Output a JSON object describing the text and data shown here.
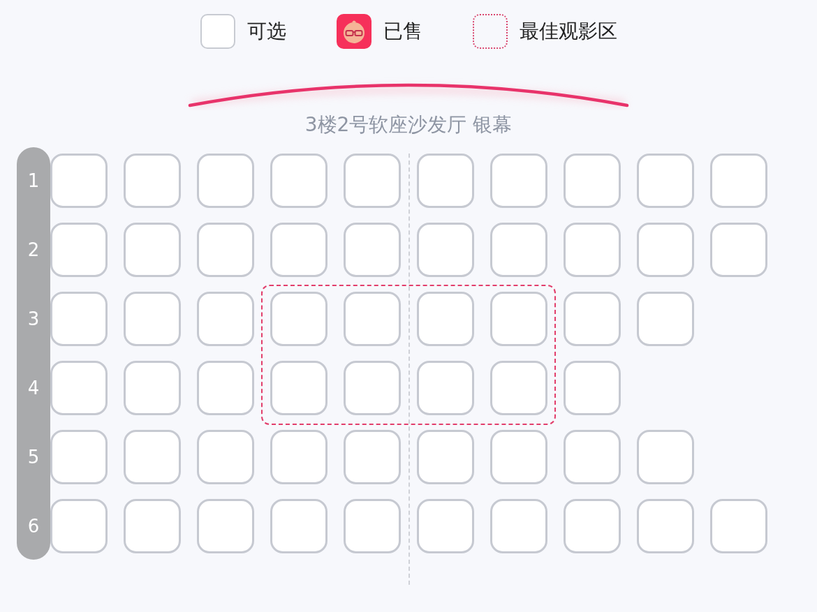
{
  "legend": [
    {
      "kind": "available",
      "label": "可选"
    },
    {
      "kind": "sold",
      "label": "已售"
    },
    {
      "kind": "best",
      "label": "最佳观影区"
    }
  ],
  "screen": {
    "label": "3楼2号软座沙发厅 银幕"
  },
  "rows": [
    {
      "label": "1",
      "best": false,
      "seats": [
        {
          "sold": false
        },
        {
          "sold": false
        },
        {
          "sold": false
        },
        {
          "sold": false
        },
        {
          "sold": false
        },
        {
          "sold": false
        },
        {
          "sold": false
        },
        {
          "sold": false
        },
        {
          "sold": false
        },
        {
          "sold": false
        }
      ]
    },
    {
      "label": "2",
      "best": false,
      "seats": [
        {
          "sold": false
        },
        {
          "sold": false
        },
        {
          "sold": false
        },
        {
          "sold": false
        },
        {
          "sold": false
        },
        {
          "sold": false
        },
        {
          "sold": false
        },
        {
          "sold": false
        },
        {
          "sold": false
        },
        {
          "sold": false
        }
      ]
    },
    {
      "label": "3",
      "best": true,
      "seats": [
        {
          "sold": false
        },
        {
          "sold": false
        },
        {
          "sold": false
        },
        {
          "sold": false
        },
        {
          "sold": false
        },
        {
          "sold": false
        },
        {
          "sold": false
        },
        {
          "sold": false
        },
        {
          "sold": false
        }
      ]
    },
    {
      "label": "4",
      "best": true,
      "seats": [
        {
          "sold": false
        },
        {
          "sold": false
        },
        {
          "sold": false
        },
        {
          "sold": false
        },
        {
          "sold": false
        },
        {
          "sold": false
        },
        {
          "sold": false
        },
        {
          "sold": false
        }
      ]
    },
    {
      "label": "5",
      "best": false,
      "seats": [
        {
          "sold": false
        },
        {
          "sold": false
        },
        {
          "sold": false
        },
        {
          "sold": false
        },
        {
          "sold": false
        },
        {
          "sold": false
        },
        {
          "sold": false
        },
        {
          "sold": false
        },
        {
          "sold": false
        }
      ]
    },
    {
      "label": "6",
      "best": false,
      "seats": [
        {
          "sold": false
        },
        {
          "sold": false
        },
        {
          "sold": false
        },
        {
          "sold": false
        },
        {
          "sold": false
        },
        {
          "sold": false
        },
        {
          "sold": false
        },
        {
          "sold": false
        },
        {
          "sold": false
        },
        {
          "sold": false
        }
      ]
    }
  ]
}
